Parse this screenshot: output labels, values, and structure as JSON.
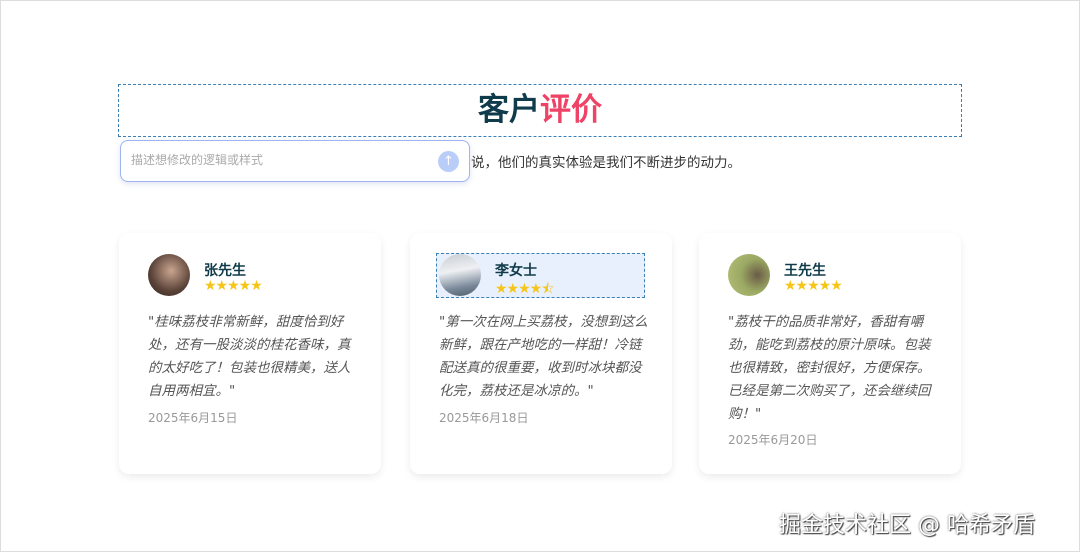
{
  "section": {
    "title_main": "客户",
    "title_highlight": "评价",
    "subtitle_visible": "说，他们的真实体验是我们不断进步的动力。"
  },
  "editor": {
    "placeholder": "描述想修改的逻辑或样式",
    "send_icon": "↑"
  },
  "reviews": [
    {
      "name": "张先生",
      "stars": "★★★★★",
      "rating": 5,
      "text": "\"桂味荔枝非常新鲜，甜度恰到好处，还有一股淡淡的桂花香味，真的太好吃了！包装也很精美，送人自用两相宜。\"",
      "date": "2025年6月15日"
    },
    {
      "name": "李女士",
      "stars": "★★★★⯪",
      "rating": 4.5,
      "text": "\"第一次在网上买荔枝，没想到这么新鲜，跟在产地吃的一样甜！冷链配送真的很重要，收到时冰块都没化完，荔枝还是冰凉的。\"",
      "date": "2025年6月18日"
    },
    {
      "name": "王先生",
      "stars": "★★★★★",
      "rating": 5,
      "text": "\"荔枝干的品质非常好，香甜有嚼劲，能吃到荔枝的原汁原味。包装也很精致，密封很好，方便保存。已经是第二次购买了，还会继续回购！\"",
      "date": "2025年6月20日"
    }
  ],
  "watermark": "掘金技术社区 @ 哈希矛盾"
}
